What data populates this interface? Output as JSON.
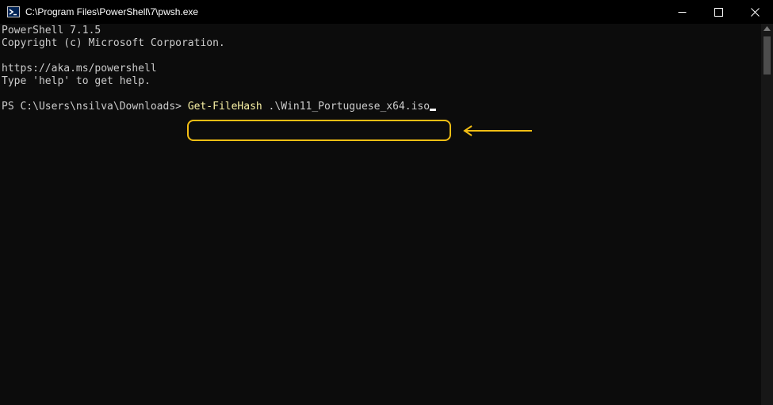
{
  "window": {
    "title": "C:\\Program Files\\PowerShell\\7\\pwsh.exe",
    "icon": "powershell-icon",
    "controls": [
      "minimize-icon",
      "maximize-icon",
      "close-icon"
    ]
  },
  "console": {
    "line1": "PowerShell 7.1.5",
    "line2": "Copyright (c) Microsoft Corporation.",
    "line3": "https://aka.ms/powershell",
    "line4": "Type 'help' to get help.",
    "prompt": "PS C:\\Users\\nsilva\\Downloads> ",
    "command": "Get-FileHash",
    "argument": " .\\Win11_Portuguese_x64.iso"
  },
  "annotation": {
    "color": "#f3be14",
    "arrow_icon": "left-arrow-icon"
  },
  "colors": {
    "background": "#0c0c0c",
    "text": "#cccccc",
    "command": "#f9f1a5"
  }
}
